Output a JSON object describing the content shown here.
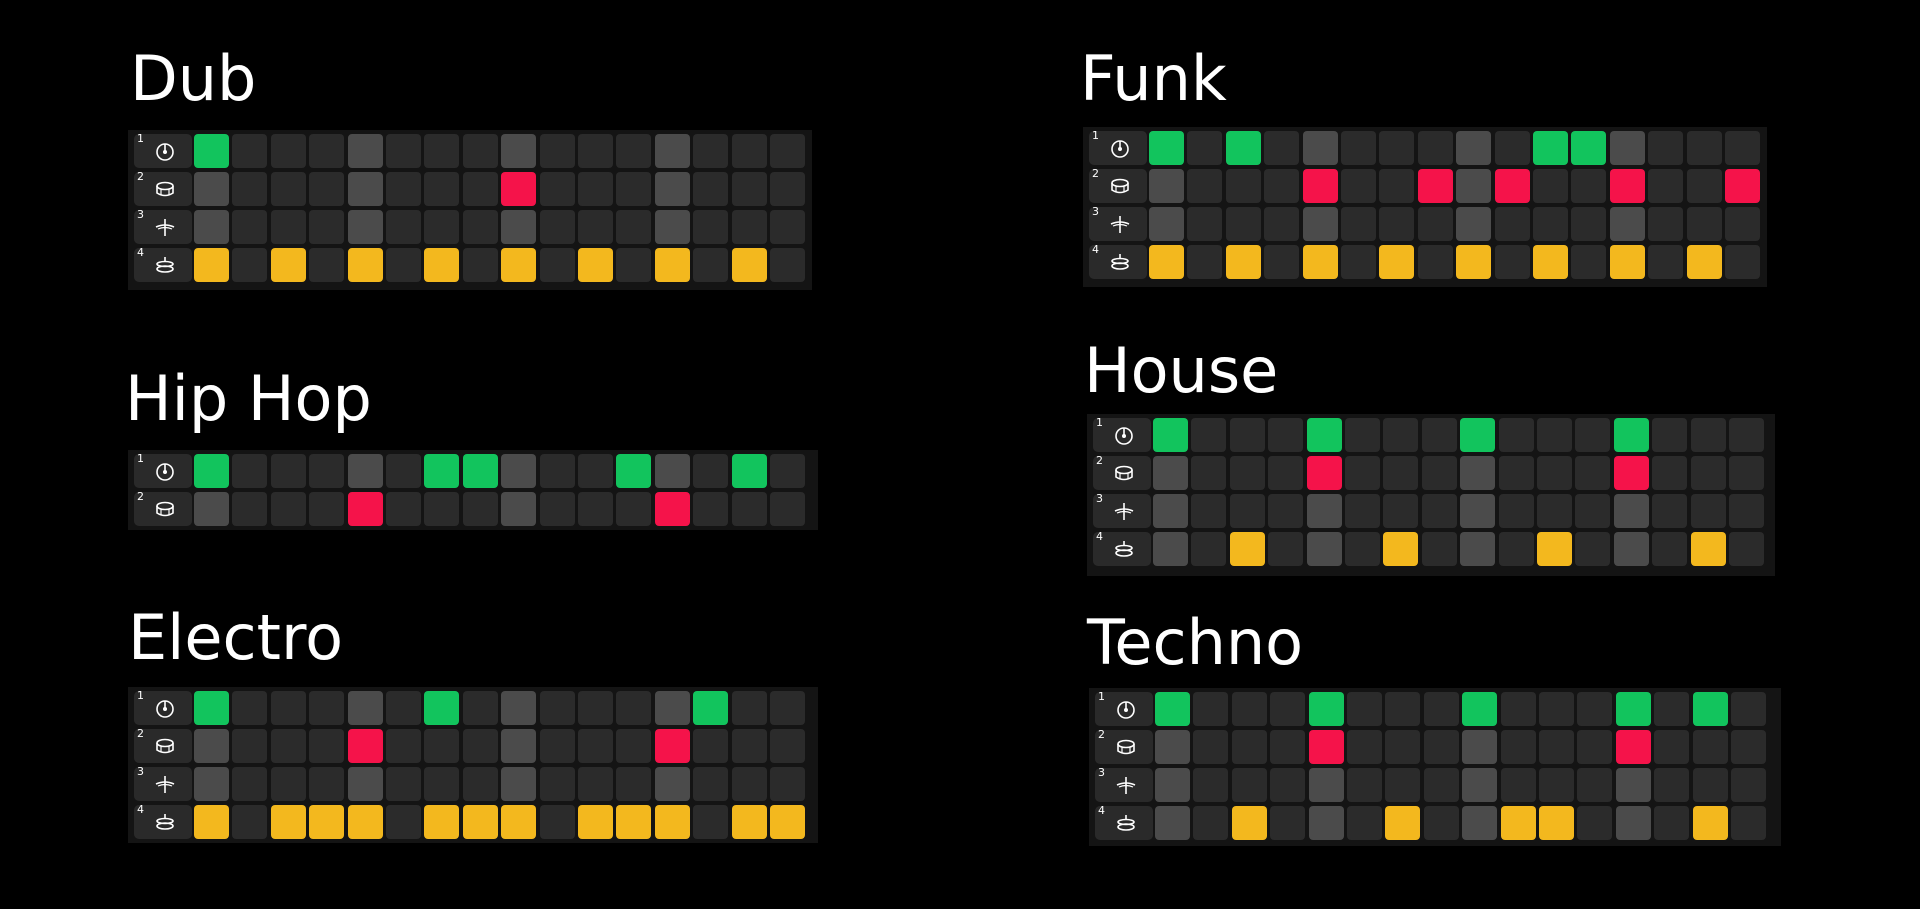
{
  "colors": {
    "background": "#000000",
    "grid_bg": "#141414",
    "cell_off": "#2b2b2b",
    "cell_beat": "#4b4b4b",
    "kick": "#12c45d",
    "snare": "#f5134a",
    "hat": "#f3b81e"
  },
  "track_icons": [
    "kick-drum-icon",
    "snare-drum-icon",
    "hi-hat-icon",
    "cymbal-icon"
  ],
  "patterns": [
    {
      "name": "Dub",
      "rows": [
        {
          "num": "1",
          "icon": "kick-drum-icon",
          "steps": "k000b000b000b000"
        },
        {
          "num": "2",
          "icon": "snare-drum-icon",
          "steps": "b000b000s000b000"
        },
        {
          "num": "3",
          "icon": "hi-hat-icon",
          "steps": "b000b000b000b000"
        },
        {
          "num": "4",
          "icon": "cymbal-icon",
          "steps": "h0h0h0h0h0h0h0h0"
        }
      ]
    },
    {
      "name": "Funk",
      "rows": [
        {
          "num": "1",
          "icon": "kick-drum-icon",
          "steps": "k0k0b000b0kkb000"
        },
        {
          "num": "2",
          "icon": "snare-drum-icon",
          "steps": "b000s00sbs00s00s"
        },
        {
          "num": "3",
          "icon": "hi-hat-icon",
          "steps": "b000b000b000b000"
        },
        {
          "num": "4",
          "icon": "cymbal-icon",
          "steps": "h0h0h0h0h0h0h0h0"
        }
      ]
    },
    {
      "name": "Hip Hop",
      "rows": [
        {
          "num": "1",
          "icon": "kick-drum-icon",
          "steps": "k000b0kkb00kb0k0"
        },
        {
          "num": "2",
          "icon": "snare-drum-icon",
          "steps": "b000s000b000s000"
        }
      ]
    },
    {
      "name": "House",
      "rows": [
        {
          "num": "1",
          "icon": "kick-drum-icon",
          "steps": "k000k000k000k000"
        },
        {
          "num": "2",
          "icon": "snare-drum-icon",
          "steps": "b000s000b000s000"
        },
        {
          "num": "3",
          "icon": "hi-hat-icon",
          "steps": "b000b000b000b000"
        },
        {
          "num": "4",
          "icon": "cymbal-icon",
          "steps": "b0h0b0h0b0h0b0h0"
        }
      ]
    },
    {
      "name": "Electro",
      "rows": [
        {
          "num": "1",
          "icon": "kick-drum-icon",
          "steps": "k000b0k0b000bk00"
        },
        {
          "num": "2",
          "icon": "snare-drum-icon",
          "steps": "b000s000b000s000"
        },
        {
          "num": "3",
          "icon": "hi-hat-icon",
          "steps": "b000b000b000b000"
        },
        {
          "num": "4",
          "icon": "cymbal-icon",
          "steps": "h0hhh0hhh0hhh0hh"
        }
      ]
    },
    {
      "name": "Techno",
      "rows": [
        {
          "num": "1",
          "icon": "kick-drum-icon",
          "steps": "k000k000k000k0k0"
        },
        {
          "num": "2",
          "icon": "snare-drum-icon",
          "steps": "b000s000b000s000"
        },
        {
          "num": "3",
          "icon": "hi-hat-icon",
          "steps": "b000b000b000b000"
        },
        {
          "num": "4",
          "icon": "cymbal-icon",
          "steps": "b0h0b0h0bhh0b0h0"
        }
      ]
    }
  ]
}
